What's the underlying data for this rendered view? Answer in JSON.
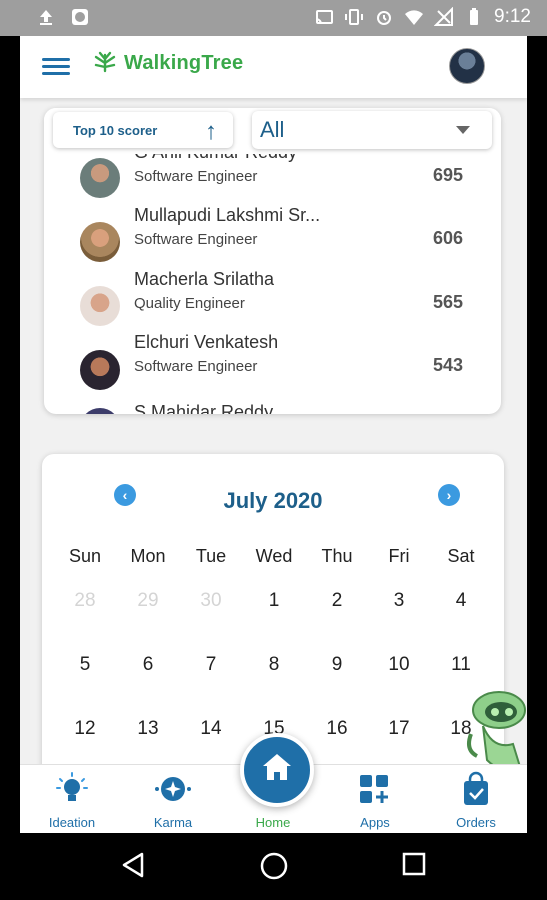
{
  "status_bar": {
    "time": "9:12"
  },
  "app": {
    "logo_text": "WalkingTree",
    "brand_color": "#1f6fa8",
    "logo_color": "#3aa84a"
  },
  "scoreboard": {
    "sort_button_label": "Top 10 scorer",
    "filter_value": "All",
    "rows": [
      {
        "name": "G Anil Kumar Reddy",
        "role": "Software Engineer",
        "points": "695"
      },
      {
        "name": "Mullapudi Lakshmi Sr...",
        "role": "Software Engineer",
        "points": "606"
      },
      {
        "name": "Macherla Srilatha",
        "role": "Quality Engineer",
        "points": "565"
      },
      {
        "name": "Elchuri Venkatesh",
        "role": "Software Engineer",
        "points": "543"
      },
      {
        "name": "S Mahidar Reddy",
        "role": "",
        "points": ""
      }
    ]
  },
  "calendar": {
    "title": "July 2020",
    "weekdays": [
      "Sun",
      "Mon",
      "Tue",
      "Wed",
      "Thu",
      "Fri",
      "Sat"
    ],
    "weeks": [
      [
        "28",
        "29",
        "30",
        "1",
        "2",
        "3",
        "4"
      ],
      [
        "5",
        "6",
        "7",
        "8",
        "9",
        "10",
        "11"
      ],
      [
        "12",
        "13",
        "14",
        "15",
        "16",
        "17",
        "18"
      ]
    ]
  },
  "bottom_nav": {
    "items": [
      {
        "label": "Ideation",
        "icon": "lightbulb-icon"
      },
      {
        "label": "Karma",
        "icon": "karma-icon"
      },
      {
        "label": "Home",
        "icon": "home-icon"
      },
      {
        "label": "Apps",
        "icon": "apps-icon"
      },
      {
        "label": "Orders",
        "icon": "shopping-bag-icon"
      }
    ]
  }
}
